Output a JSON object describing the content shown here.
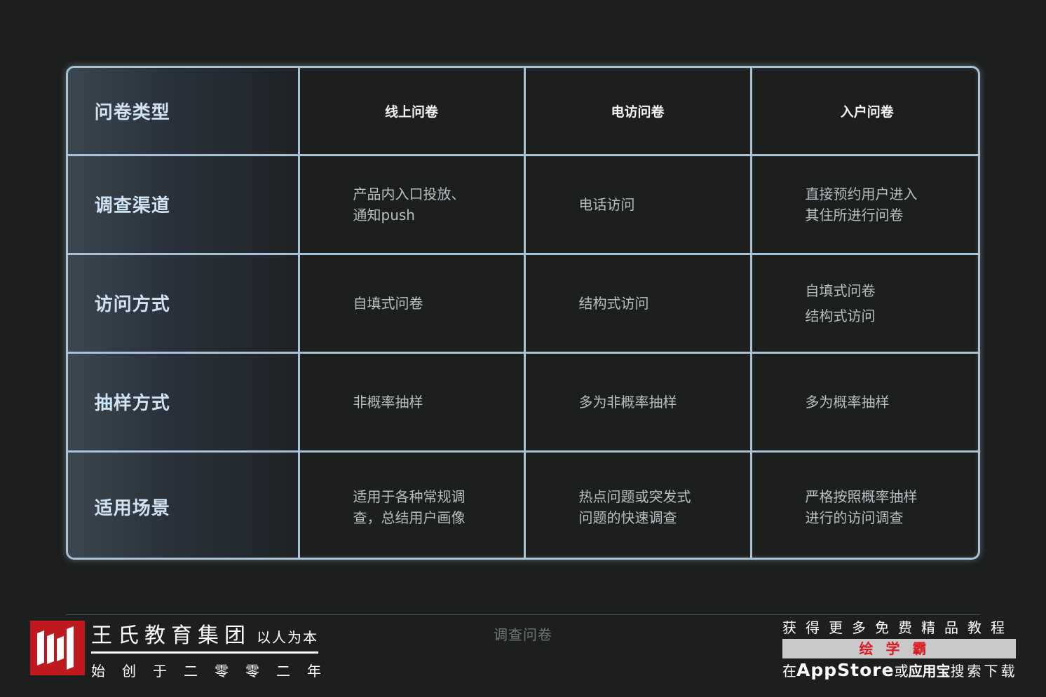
{
  "table": {
    "header": {
      "label": "问卷类型",
      "columns": [
        "线上问卷",
        "电访问卷",
        "入户问卷"
      ]
    },
    "rows": [
      {
        "label": "调查渠道",
        "cells": [
          [
            "产品内入口投放、",
            "通知push"
          ],
          [
            "电话访问"
          ],
          [
            "直接预约用户进入",
            "其住所进行问卷"
          ]
        ]
      },
      {
        "label": "访问方式",
        "cells": [
          [
            "自填式问卷"
          ],
          [
            "结构式访问"
          ],
          [
            "自填式问卷",
            "结构式访问"
          ]
        ]
      },
      {
        "label": "抽样方式",
        "cells": [
          [
            "非概率抽样"
          ],
          [
            "多为非概率抽样"
          ],
          [
            "多为概率抽样"
          ]
        ]
      },
      {
        "label": "适用场景",
        "cells": [
          [
            "适用于各种常规调",
            "查，总结用户画像"
          ],
          [
            "热点问题或突发式",
            "问题的快速调查"
          ],
          [
            "严格按照概率抽样",
            "进行的访问调查"
          ]
        ]
      }
    ]
  },
  "footer": {
    "brand_name": "王氏教育集团",
    "brand_slogan": "以人为本",
    "brand_sub": "始创于二零零二年",
    "caption": "调查问卷",
    "promo_top": "获得更多免费精品教程",
    "promo_brand": "绘学霸",
    "promo_prefix": "在",
    "promo_app": "AppStore",
    "promo_or": "或",
    "promo_store": "应用宝",
    "promo_suffix": "搜索下载"
  },
  "colors": {
    "background": "#1d1e1e",
    "grid_line": "#a9c3d6",
    "logo_red": "#c0181f",
    "promo_red": "#d81c22"
  },
  "icons": {
    "logo": "wang-logo-icon"
  }
}
